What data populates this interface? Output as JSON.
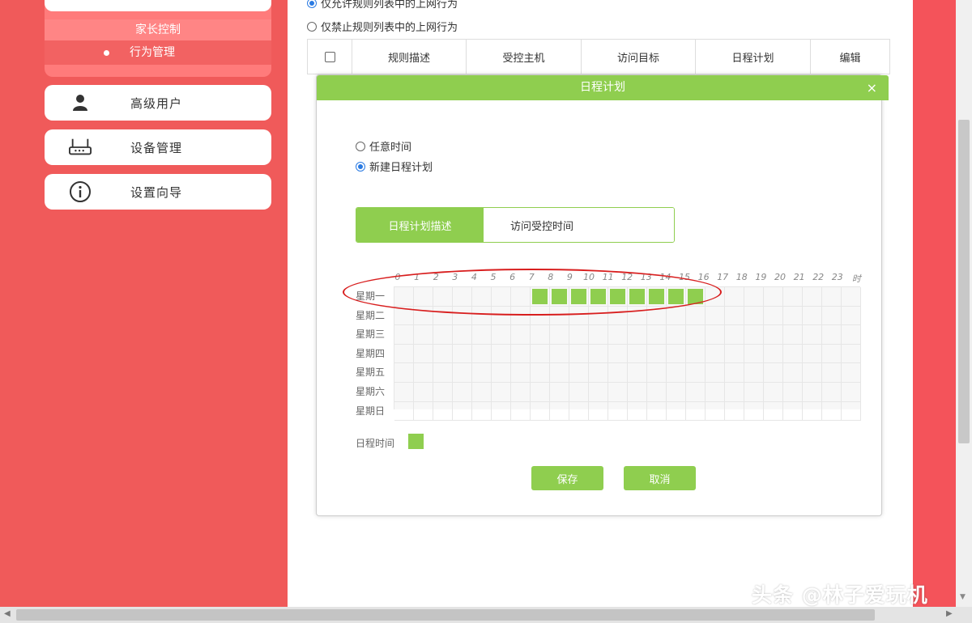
{
  "sidebar": {
    "parental_control": "家长控制",
    "behavior_management": "行为管理",
    "items": [
      {
        "label": "高级用户",
        "icon": "user-icon"
      },
      {
        "label": "设备管理",
        "icon": "router-icon"
      },
      {
        "label": "设置向导",
        "icon": "info-icon"
      }
    ]
  },
  "main": {
    "radio_allow": "仅允许规则列表中的上网行为",
    "radio_block": "仅禁止规则列表中的上网行为",
    "table_headers": [
      "规则描述",
      "受控主机",
      "访问目标",
      "日程计划",
      "编辑"
    ]
  },
  "modal": {
    "title": "日程计划",
    "close": "×",
    "option_any_time": "任意时间",
    "option_new_schedule": "新建日程计划",
    "tab_schedule_desc": "日程计划描述",
    "tab_access_time": "访问受控时间",
    "hours": [
      "0",
      "1",
      "2",
      "3",
      "4",
      "5",
      "6",
      "7",
      "8",
      "9",
      "10",
      "11",
      "12",
      "13",
      "14",
      "15",
      "16",
      "17",
      "18",
      "19",
      "20",
      "21",
      "22",
      "23",
      "时"
    ],
    "days": [
      "星期一",
      "星期二",
      "星期三",
      "星期四",
      "星期五",
      "星期六",
      "星期日"
    ],
    "selected": {
      "day": "星期一",
      "hours": [
        7,
        8,
        9,
        10,
        11,
        12,
        13,
        14,
        15
      ]
    },
    "legend_label": "日程时间",
    "save": "保存",
    "cancel": "取消"
  },
  "watermark": "头条 @林子爱玩机",
  "colors": {
    "accent": "#8fce4f",
    "sidebar": "#f05a5a",
    "annotation": "#d81e1e"
  }
}
